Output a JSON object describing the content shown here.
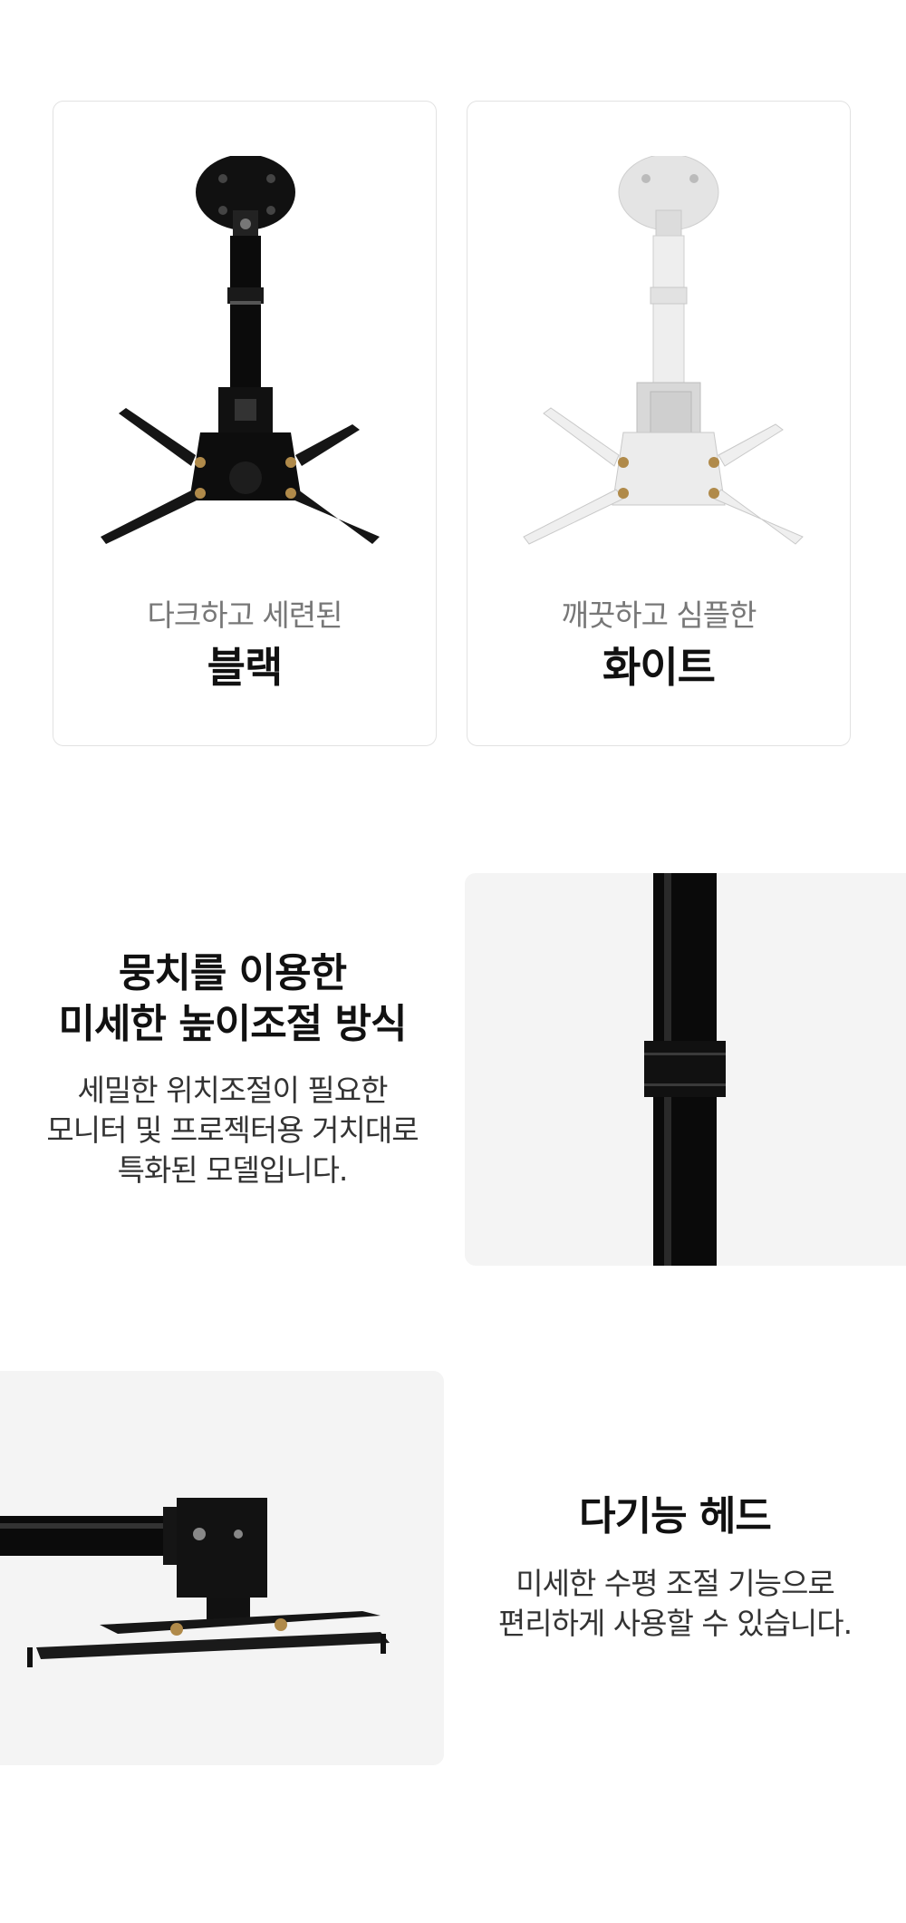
{
  "colors": {
    "card_border": "#e2e2e2",
    "photo_bg": "#f4f4f4",
    "accent_text": "#111111",
    "sub_text": "#777777"
  },
  "variants": [
    {
      "subtitle": "다크하고 세련된",
      "name": "블랙",
      "product_color": "black"
    },
    {
      "subtitle": "깨끗하고 심플한",
      "name": "화이트",
      "product_color": "white"
    }
  ],
  "feature_height": {
    "title_lines": [
      "뭉치를 이용한",
      "미세한 높이조절 방식"
    ],
    "desc_lines": [
      "세밀한 위치조절이 필요한",
      "모니터 및 프로젝터용 거치대로",
      "특화된 모델입니다."
    ]
  },
  "feature_head": {
    "title": "다기능 헤드",
    "desc_lines": [
      "미세한 수평 조절 기능으로",
      "편리하게 사용할 수 있습니다."
    ]
  }
}
